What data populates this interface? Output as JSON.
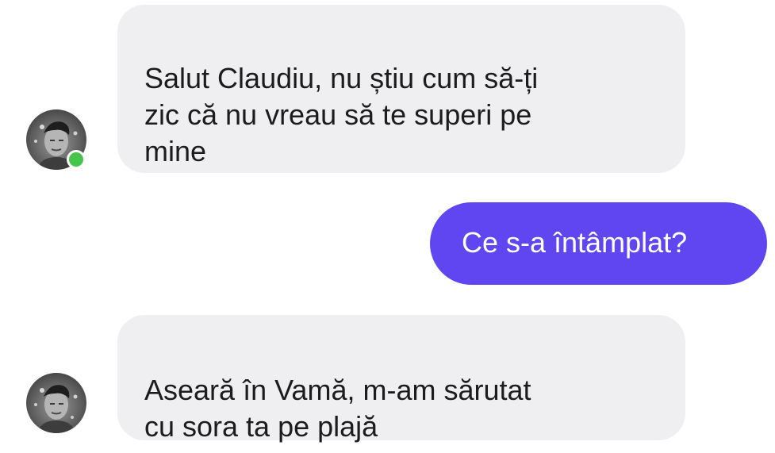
{
  "messages": [
    {
      "direction": "incoming",
      "text": "Salut Claudiu, nu știu cum să-ți\nzic că nu vreau să te superi pe\nmine"
    },
    {
      "direction": "outgoing",
      "text": "Ce s-a întâmplat?"
    },
    {
      "direction": "incoming",
      "text": "Aseară în Vamă, m-am sărutat\ncu sora ta pe plajă"
    }
  ],
  "contact": {
    "avatar_icon": "user-photo-avatar",
    "online_status": "online",
    "online_color": "#47c44a"
  },
  "colors": {
    "incoming_bubble": "#efeff1",
    "outgoing_bubble": "#6046f0"
  }
}
